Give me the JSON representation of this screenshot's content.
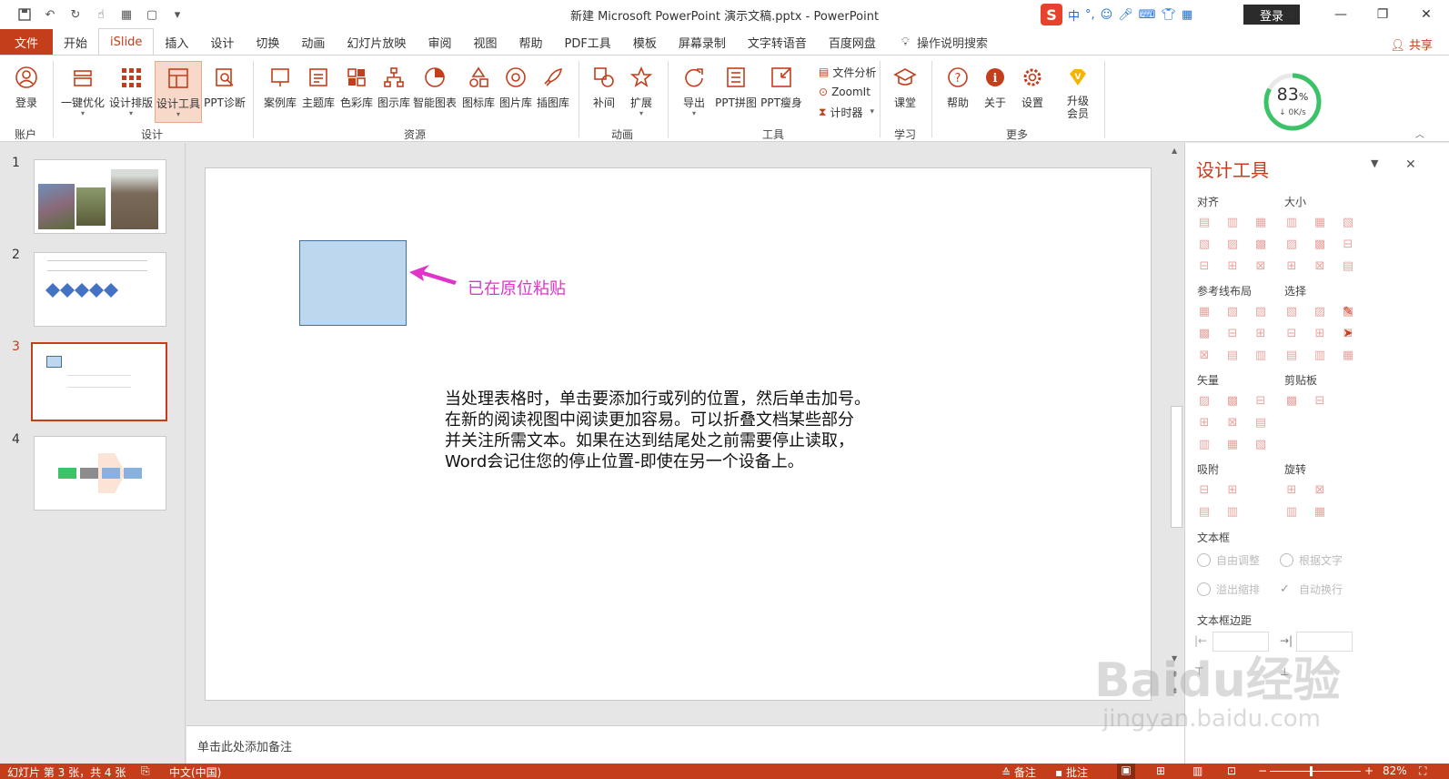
{
  "window": {
    "title": "新建 Microsoft PowerPoint 演示文稿.pptx  -  PowerPoint",
    "login": "登录"
  },
  "ime": {
    "logo": "S",
    "lang": "中"
  },
  "tabs": {
    "file": "文件",
    "items": [
      "开始",
      "iSlide",
      "插入",
      "设计",
      "切换",
      "动画",
      "幻灯片放映",
      "审阅",
      "视图",
      "帮助",
      "PDF工具",
      "模板",
      "屏幕录制",
      "文字转语音",
      "百度网盘"
    ],
    "tell_me": "操作说明搜索",
    "share": "共享"
  },
  "ribbon": {
    "buttons": {
      "login": "登录",
      "optimize": "一键优化",
      "layout": "设计排版",
      "design_tools": "设计工具",
      "ppt_diag": "PPT诊断",
      "cases": "案例库",
      "themes": "主题库",
      "colors": "色彩库",
      "diagrams": "图示库",
      "smart_chart": "智能图表",
      "icons": "图标库",
      "pictures": "图片库",
      "illustrations": "插图库",
      "tween": "补间",
      "extend": "扩展",
      "export": "导出",
      "ppt_collage": "PPT拼图",
      "ppt_slim": "PPT瘦身",
      "file_analysis": "文件分析",
      "zoomit": "ZoomIt",
      "timer": "计时器",
      "classroom": "课堂",
      "help": "帮助",
      "about": "关于",
      "settings": "设置",
      "upgrade": "升级\n会员"
    },
    "groups": {
      "account": "账户",
      "design": "设计",
      "resources": "资源",
      "animation": "动画",
      "tools": "工具",
      "learn": "学习",
      "more": "更多"
    },
    "speed": {
      "percent": "83",
      "unit": "%",
      "rate": "↓ 0K/s"
    }
  },
  "thumbnails": [
    {
      "num": "1"
    },
    {
      "num": "2"
    },
    {
      "num": "3"
    },
    {
      "num": "4"
    }
  ],
  "slide": {
    "annotation": "已在原位粘贴",
    "body_lines": [
      "当处理表格时，单击要添加行或列的位置，然后单击加号。",
      "在新的阅读视图中阅读更加容易。可以折叠文档某些部分",
      "并关注所需文本。如果在达到结尾处之前需要停止读取，",
      "Word会记住您的停止位置-即使在另一个设备上。"
    ]
  },
  "notes": {
    "placeholder": "单击此处添加备注"
  },
  "pane": {
    "title": "设计工具",
    "sections": {
      "align": "对齐",
      "size": "大小",
      "guides": "参考线布局",
      "select": "选择",
      "vector": "矢量",
      "clipboard": "剪贴板",
      "snap": "吸附",
      "rotate": "旋转",
      "textbox": "文本框",
      "text_margin": "文本框边距"
    },
    "textbox_opts": {
      "auto_fit": "自由调整",
      "fit_text": "根据文字",
      "shrink": "溢出缩排",
      "wrap": "自动换行"
    }
  },
  "statusbar": {
    "slide_info": "幻灯片 第 3 张，共 4 张",
    "language": "中文(中国)",
    "notes": "备注",
    "comments": "批注",
    "zoom": "82%"
  },
  "watermark": {
    "main": "Baidu经验",
    "sub": "jingyan.baidu.com"
  },
  "colors": {
    "accent": "#c43e1c",
    "annotation": "#e033c9",
    "shape_fill": "#bdd7ee",
    "shape_border": "#41719c"
  }
}
